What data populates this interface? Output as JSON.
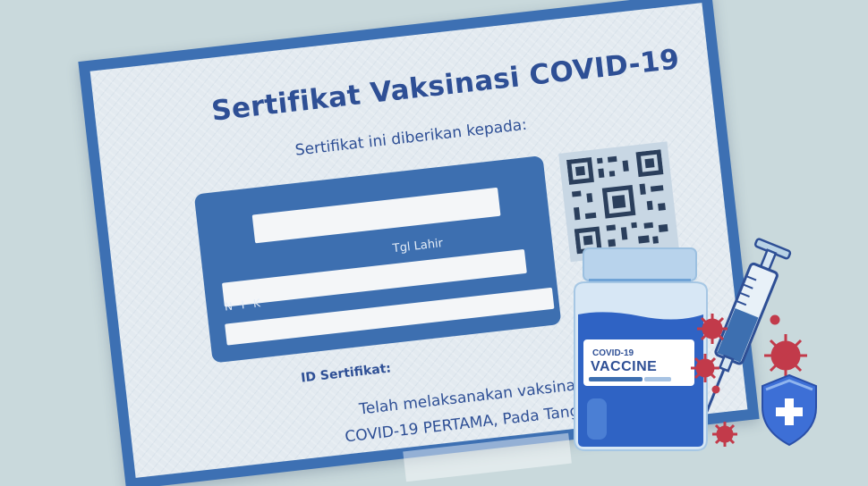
{
  "certificate": {
    "title": "Sertifikat Vaksinasi COVID-19",
    "subtitle": "Sertifikat ini diberikan kepada:",
    "dob_label": "Tgl Lahir",
    "nik_label": "N I K",
    "id_label": "ID Sertifikat:",
    "statement_line1": "Telah melaksanakan vaksinasi",
    "statement_line2": "COVID-19 PERTAMA, Pada Tanggal:"
  },
  "vial": {
    "line1": "COVID-19",
    "line2": "VACCINE"
  },
  "colors": {
    "background": "#c9d9dc",
    "card_border": "#3d70b3",
    "text_blue": "#2e4f95",
    "panel_blue": "#3d6fb0",
    "virus_red": "#c23a4a"
  },
  "icons": [
    "qr-code-icon",
    "vaccine-vial-icon",
    "syringe-icon",
    "virus-icon",
    "shield-plus-icon"
  ]
}
